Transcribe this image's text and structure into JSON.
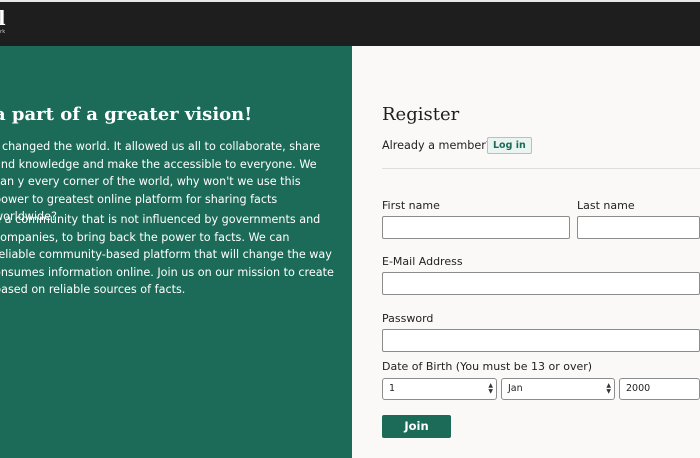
{
  "header": {
    "logo_text": "l",
    "logo_sub": "rk"
  },
  "hero": {
    "title": "a part of a greater vision!",
    "paragraph1": "t changed the world. It allowed us all to collaborate, share and knowledge and make the accessible to everyone. We can y every corner of the world, why won't we use this power to greatest online platform for sharing facts worldwide?",
    "paragraph2": "d a community that is not influenced by governments and companies, to bring back the power to facts. We can reliable community-based platform that will change the way onsumes information online. Join us on our mission to create based on reliable sources of facts."
  },
  "register": {
    "title": "Register",
    "member_text": "Already a member?",
    "login_label": "Log in",
    "first_name_label": "First name",
    "last_name_label": "Last name",
    "email_label": "E-Mail Address",
    "password_label": "Password",
    "dob_label": "Date of Birth (You must be 13 or over)",
    "dob_day": "1",
    "dob_month": "Jan",
    "dob_year": "2000",
    "join_label": "Join"
  },
  "colors": {
    "brand_green": "#1c6b58",
    "header_bg": "#1e1e1e",
    "panel_bg": "#faf9f7"
  }
}
